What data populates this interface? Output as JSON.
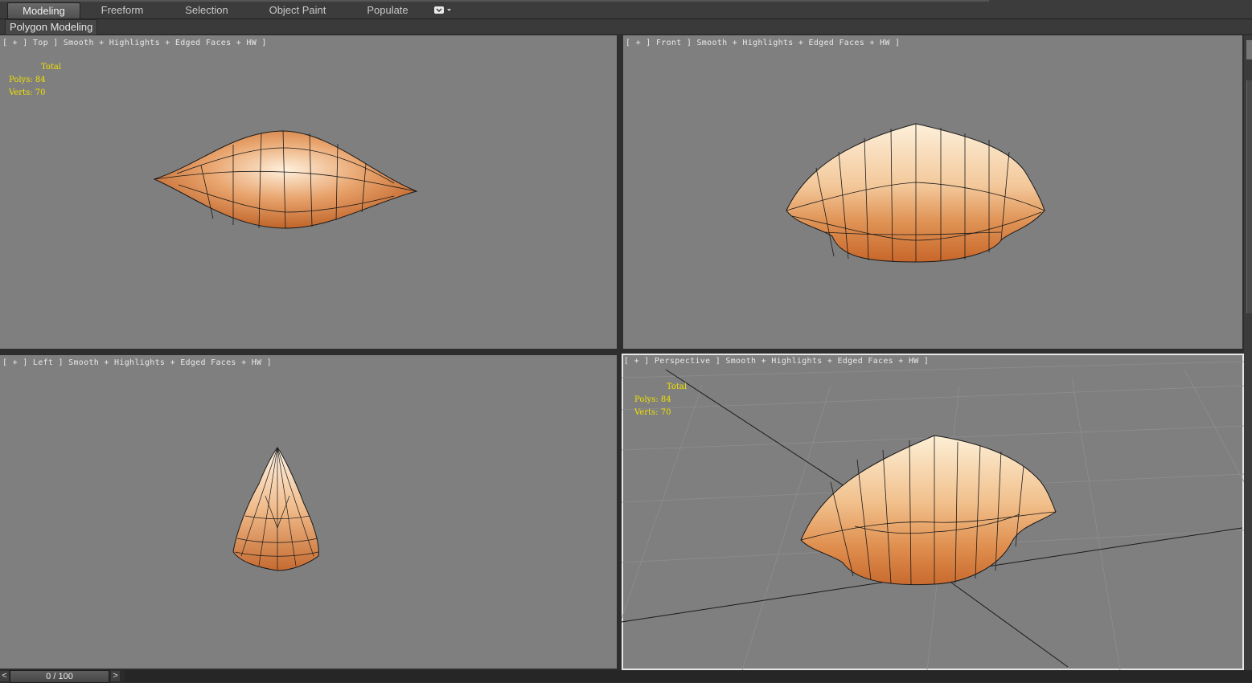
{
  "ribbon": {
    "tabs": [
      "Modeling",
      "Freeform",
      "Selection",
      "Object Paint",
      "Populate"
    ],
    "active_tab": "Modeling",
    "sub_label": "Polygon Modeling"
  },
  "viewports": {
    "top": {
      "label": "[ + ] Top ] Smooth + Highlights + Edged Faces + HW ]"
    },
    "front": {
      "label": "[ + ] Front ] Smooth + Highlights + Edged Faces + HW ]"
    },
    "left": {
      "label": "[ + ] Left ] Smooth + Highlights + Edged Faces + HW ]"
    },
    "perspective": {
      "label": "[ + ] Perspective ] Smooth + Highlights + Edged Faces + HW ]"
    }
  },
  "stats": {
    "total": "Total",
    "polys": "Polys: 84",
    "verts": "Verts: 70"
  },
  "timeline": {
    "prev": "<",
    "next": ">",
    "frame": "0 / 100"
  },
  "colors": {
    "viewport_bg": "#7f7f7f",
    "stats_text": "#f0e000",
    "mesh_light": "#fbe2c4",
    "mesh_dark": "#c66a2c"
  }
}
